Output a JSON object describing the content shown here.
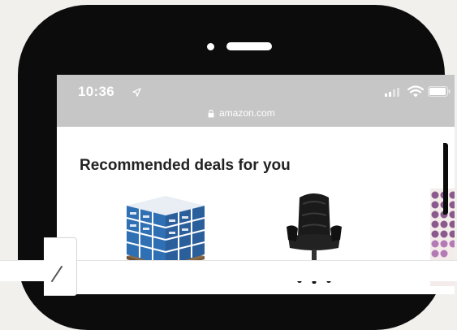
{
  "status_bar": {
    "time": "10:36",
    "url": "amazon.com",
    "icons": [
      "location-arrow-icon",
      "cellular-signal-icon",
      "wifi-icon",
      "battery-icon",
      "lock-icon"
    ]
  },
  "deals": {
    "title": "Recommended deals for you",
    "items": [
      {
        "image": "paper-cases-pallet"
      },
      {
        "image": "office-chair"
      },
      {
        "image": "coffee-pods"
      }
    ]
  },
  "colors": {
    "background": "#f1f0ec",
    "phone_bezel": "#0c0c0c",
    "status_bar": "#c6c6c6",
    "paper_box": "#2f6fb3",
    "chair": "#1a1a1a"
  }
}
